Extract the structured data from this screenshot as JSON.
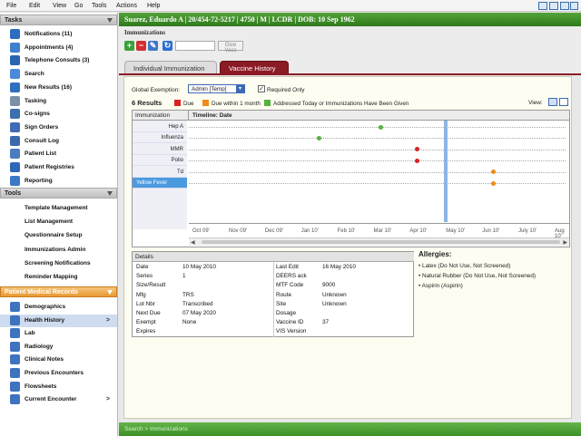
{
  "menu": [
    "File",
    "Edit",
    "View",
    "Go",
    "Tools",
    "Actions",
    "Help"
  ],
  "sidebar": {
    "tasks_header": "Tasks",
    "tasks": [
      {
        "label": "Notifications (11)",
        "icon": "notification-icon",
        "color": "#2d6cc0"
      },
      {
        "label": "Appointments (4)",
        "icon": "calendar-icon",
        "color": "#3f7fd0"
      },
      {
        "label": "Telephone Consults (3)",
        "icon": "phone-icon",
        "color": "#2a63b0"
      },
      {
        "label": "Search",
        "icon": "search-icon",
        "color": "#4a8ad8"
      },
      {
        "label": "New Results (16)",
        "icon": "results-icon",
        "color": "#2f6fbf"
      },
      {
        "label": "Tasking",
        "icon": "tasking-icon",
        "color": "#7a8fa8"
      },
      {
        "label": "Co-signs",
        "icon": "cosign-icon",
        "color": "#3c6fb0"
      },
      {
        "label": "Sign Orders",
        "icon": "sign-orders-icon",
        "color": "#3f6db5"
      },
      {
        "label": "Consult Log",
        "icon": "consult-log-icon",
        "color": "#3a6aab"
      },
      {
        "label": "Patient List",
        "icon": "patient-list-icon",
        "color": "#4b7cc0"
      },
      {
        "label": "Patient Registries",
        "icon": "registry-icon",
        "color": "#2f68b8"
      },
      {
        "label": "Reporting",
        "icon": "reporting-icon",
        "color": "#3b78c5"
      }
    ],
    "tools_header": "Tools",
    "tools": [
      "Template Management",
      "List Management",
      "Questionnaire Setup",
      "Immunizations Admin",
      "Screening Notifications",
      "Reminder Mapping"
    ],
    "pmr_header": "Patient Medical Records",
    "pmr": [
      {
        "label": "Demographics",
        "icon": "demographics-icon",
        "arrow": ""
      },
      {
        "label": "Health History",
        "icon": "health-history-icon",
        "arrow": ">"
      },
      {
        "label": "Lab",
        "icon": "lab-icon",
        "arrow": ""
      },
      {
        "label": "Radiology",
        "icon": "radiology-icon",
        "arrow": ""
      },
      {
        "label": "Clinical Notes",
        "icon": "clinical-notes-icon",
        "arrow": ""
      },
      {
        "label": "Previous Encounters",
        "icon": "previous-encounters-icon",
        "arrow": ""
      },
      {
        "label": "Flowsheets",
        "icon": "flowsheets-icon",
        "arrow": ""
      },
      {
        "label": "Current Encounter",
        "icon": "current-encounter-icon",
        "arrow": ">"
      }
    ]
  },
  "patient_bar": "Suarez, Eduardo A | 20/454-72-5217 | 4750 | M | LCDR | DOB: 10 Sep 1962",
  "title": "Immunizations",
  "toolbar": {
    "give_vacc": "Give Vacc"
  },
  "tabs": [
    "Individual Immunization",
    "Vaccine History"
  ],
  "exemption": {
    "label": "Global Exemption:",
    "value": "Admin [Temp]",
    "required_label": "Required Only",
    "required_checked": true
  },
  "results": "6 Results",
  "legend": [
    {
      "label": "Due",
      "color": "#d92323"
    },
    {
      "label": "Due within 1 month",
      "color": "#f08a1c"
    },
    {
      "label": "Addressed Today or Immunizations Have Been Given",
      "color": "#55b13f"
    }
  ],
  "view_label": "View:",
  "timeline": {
    "col_immunization": "Immunization",
    "col_timeline": "Timeline: Date",
    "rows": [
      {
        "name": "Hep A",
        "dot_color": "#55b13f",
        "month": 5.1,
        "selected": false
      },
      {
        "name": "Influenza",
        "dot_color": "#55b13f",
        "month": 3.4,
        "selected": false
      },
      {
        "name": "MMR",
        "dot_color": "#d92323",
        "month": 6.1,
        "selected": false
      },
      {
        "name": "Polio",
        "dot_color": "#d92323",
        "month": 6.1,
        "selected": false
      },
      {
        "name": "Td",
        "dot_color": "#f08a1c",
        "month": 8.2,
        "selected": false
      },
      {
        "name": "Yellow Fever",
        "dot_color": "#f08a1c",
        "month": 8.2,
        "selected": true
      }
    ],
    "today_month": 6.9,
    "months": [
      "Oct 09'",
      "Nov 09'",
      "Dec 09'",
      "Jan 10'",
      "Feb 10'",
      "Mar 10'",
      "Apr 10'",
      "May 10'",
      "Jun 10'",
      "July 10'",
      "Aug 10'"
    ]
  },
  "details": {
    "header": "Details",
    "left": [
      [
        "Date",
        "10 May 2010"
      ],
      [
        "Series",
        "1"
      ],
      [
        "Size/Result",
        ""
      ],
      [
        "Mfg",
        "TRS"
      ],
      [
        "Lot Nbr",
        "Transcribed"
      ],
      [
        "Next Due",
        "07 May 2020"
      ],
      [
        "Exempt",
        "None"
      ],
      [
        "Expires",
        ""
      ]
    ],
    "right": [
      [
        "Last Edit",
        "16 May 2010"
      ],
      [
        "DEERS ack",
        ""
      ],
      [
        "MTF Code",
        "9000"
      ],
      [
        "Route",
        "Unknown"
      ],
      [
        "Site",
        "Unknown"
      ],
      [
        "Dosage",
        ""
      ],
      [
        "Vaccine ID",
        "37"
      ],
      [
        "VIS Version",
        ""
      ]
    ]
  },
  "allergies": {
    "title": "Allergies:",
    "items": [
      "Latex (Do Not Use, Not Screened)",
      "Natural Rubber (Do Not Use, Not Screened)",
      "Aspirin (Aspirin)"
    ]
  },
  "status": "Search > Immunizations"
}
